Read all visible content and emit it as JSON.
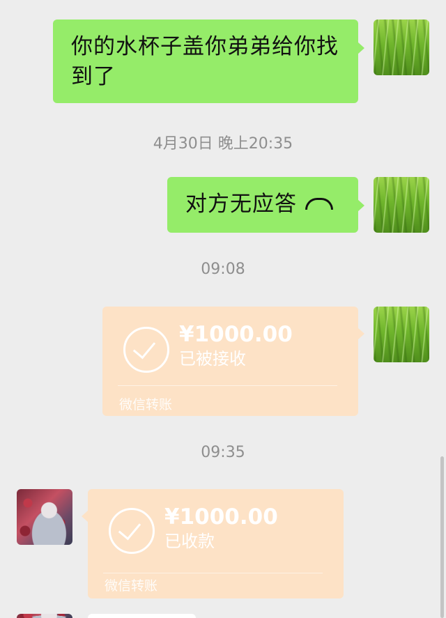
{
  "messages": {
    "msg1": {
      "text": "你的水杯子盖你弟弟给你找到了"
    },
    "time1": "4月30日 晚上20:35",
    "msg2": {
      "text": "对方无应答",
      "icon": "hangup-phone-icon"
    },
    "time2": "09:08",
    "transfer1": {
      "amount": "¥1000.00",
      "status": "已被接收",
      "service": "微信转账"
    },
    "time3": "09:35",
    "transfer2": {
      "amount": "¥1000.00",
      "status": "已收款",
      "service": "微信转账"
    }
  },
  "colors": {
    "background": "#ededed",
    "green_bubble": "#95ec69",
    "transfer_bubble": "#fde2c6",
    "timestamp": "#8e8e8e"
  }
}
